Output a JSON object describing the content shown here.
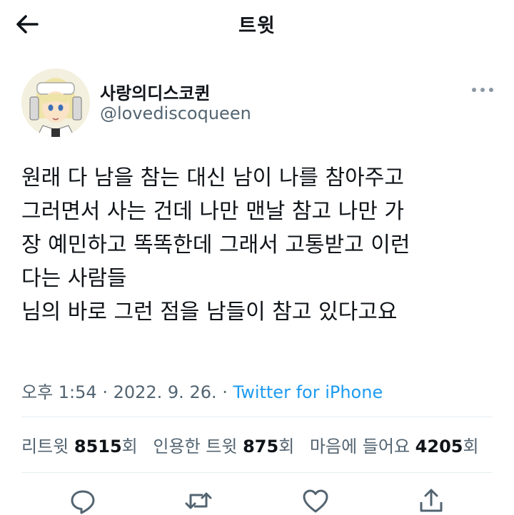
{
  "header": {
    "title": "트윗"
  },
  "author": {
    "display_name": "사랑의디스코퀸",
    "handle": "@lovediscoqueen"
  },
  "tweet": {
    "lines": [
      "원래 다 남을 참는 대신 남이 나를 참아주고",
      "그러면서 사는 건데 나만 맨날 참고 나만 가",
      "장 예민하고 똑똑한데 그래서 고통받고 이런",
      "다는 사람들",
      "님의 바로 그런 점을 남들이 참고 있다고요"
    ]
  },
  "meta": {
    "time": "오후 1:54",
    "separator": " · ",
    "date": "2022. 9. 26.",
    "source": "Twitter for iPhone"
  },
  "stats": {
    "retweets_label": "리트윗 ",
    "retweets": "8515",
    "retweets_unit": "회",
    "quotes_label": "인용한 트윗 ",
    "quotes": "875",
    "quotes_unit": "회",
    "likes_label": "마음에 들어요 ",
    "likes": "4205",
    "likes_unit": "회"
  },
  "colors": {
    "accent": "#1d9bf0",
    "secondary_text": "#536471",
    "primary_text": "#0f1419"
  },
  "icons": [
    "back-arrow-icon",
    "more-icon",
    "reply-icon",
    "retweet-icon",
    "like-icon",
    "share-icon"
  ]
}
